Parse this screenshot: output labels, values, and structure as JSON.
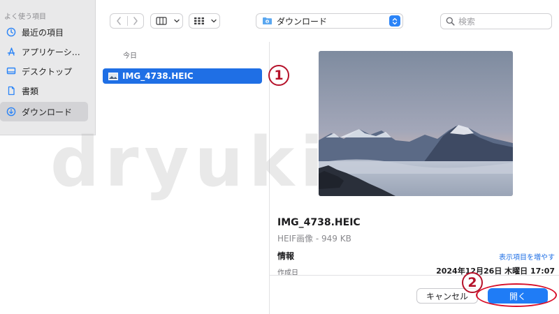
{
  "sidebar": {
    "header": "よく使う項目",
    "items": [
      {
        "label": "最近の項目",
        "icon": "clock-icon"
      },
      {
        "label": "アプリケーション",
        "icon": "applications-icon"
      },
      {
        "label": "デスクトップ",
        "icon": "desktop-icon"
      },
      {
        "label": "書類",
        "icon": "document-icon"
      },
      {
        "label": "ダウンロード",
        "icon": "download-icon",
        "selected": true
      }
    ]
  },
  "toolbar": {
    "location_label": "ダウンロード",
    "search_placeholder": "検索"
  },
  "file_list": {
    "group": "今日",
    "files": [
      {
        "name": "IMG_4738.HEIC",
        "selected": true
      }
    ]
  },
  "preview": {
    "name": "IMG_4738.HEIC",
    "kind": "HEIF画像 - 949 KB",
    "info_header": "情報",
    "show_more": "表示項目を増やす",
    "created_label": "作成日",
    "created_value": "2024年12月26日 木曜日 17:07"
  },
  "buttons": {
    "cancel": "キャンセル",
    "open": "開く"
  },
  "annotations": {
    "step1": "1",
    "step2": "2"
  },
  "watermark": "dryuki",
  "colors": {
    "accent": "#1f6fe5",
    "annotation": "#b5122a"
  }
}
